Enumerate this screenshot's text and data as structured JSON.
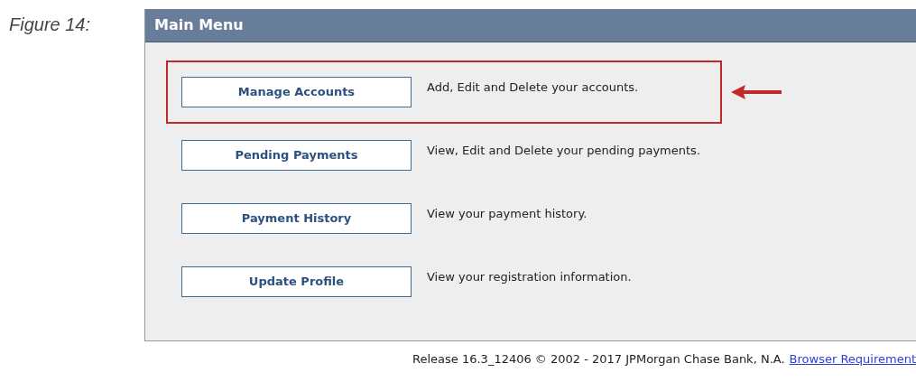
{
  "figure_label": "Figure 14:",
  "panel": {
    "title": "Main Menu"
  },
  "menu_items": [
    {
      "label": "Manage Accounts",
      "description": "Add, Edit and Delete your accounts.",
      "highlighted": true
    },
    {
      "label": "Pending Payments",
      "description": "View, Edit and Delete your pending payments.",
      "highlighted": false
    },
    {
      "label": "Payment History",
      "description": "View your payment history.",
      "highlighted": false
    },
    {
      "label": "Update Profile",
      "description": "View your registration information.",
      "highlighted": false
    }
  ],
  "footer": {
    "text": "Release 16.3_12406 © 2002 - 2017 JPMorgan Chase Bank, N.A.",
    "link": "Browser Requirement"
  }
}
